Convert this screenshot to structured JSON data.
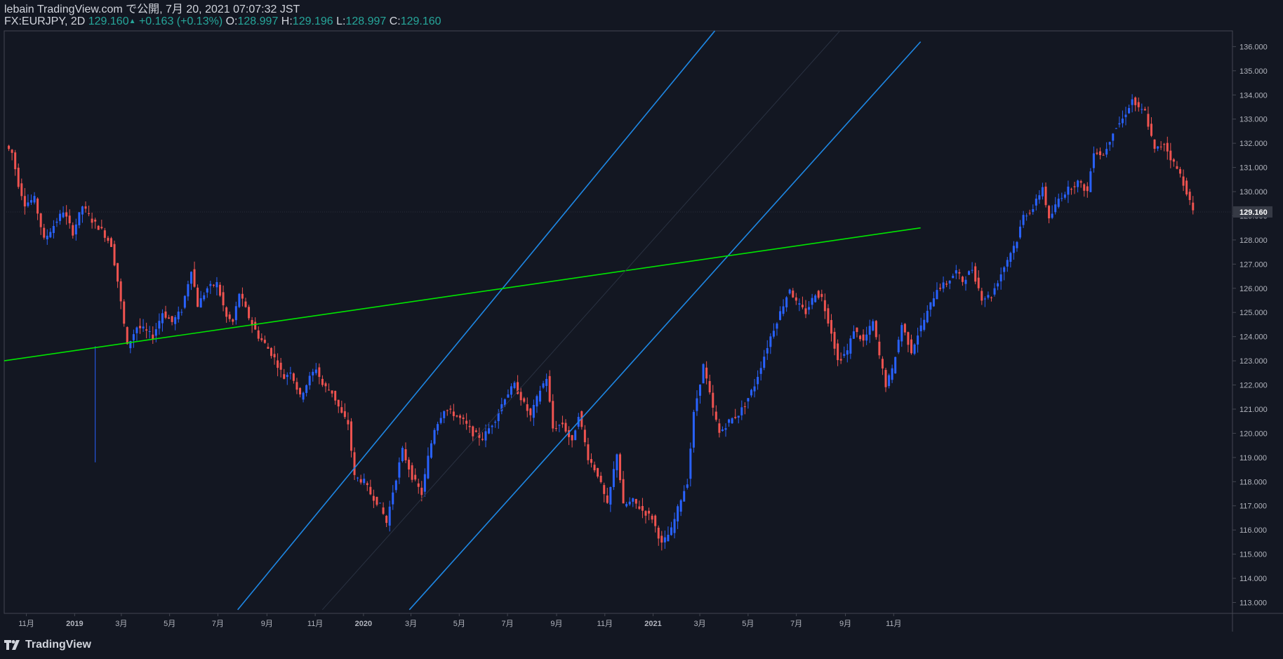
{
  "header": {
    "publisher": "lebain TradingView.com で公開, 7月 20, 2021 07:07:32 JST",
    "symbol": "FX:EURJPY, 2D",
    "last": "129.160",
    "change": "+0.163 (+0.13%)",
    "o_label": "O:",
    "o_value": "128.997",
    "h_label": "H:",
    "h_value": "129.196",
    "l_label": "L:",
    "l_value": "128.997",
    "c_label": "C:",
    "c_value": "129.160"
  },
  "footer": {
    "brand": "TradingView",
    "logo_icon": "tradingview-logo-icon"
  },
  "colors": {
    "background": "#131722",
    "up": "#2962ff",
    "down": "#ef5350",
    "channel": "#1e88e5",
    "support": "#00e600",
    "axis": "#787b86",
    "price_tag_bg": "#363a45"
  },
  "chart_data": {
    "type": "candlestick",
    "symbol": "EURJPY",
    "interval": "2D",
    "xlabels": [
      "11月",
      "2019",
      "3月",
      "5月",
      "7月",
      "9月",
      "11月",
      "2020",
      "3月",
      "5月",
      "7月",
      "9月",
      "11月",
      "2021",
      "3月",
      "5月",
      "7月",
      "9月",
      "11月"
    ],
    "yticks": [
      "113.000",
      "114.000",
      "115.000",
      "116.000",
      "117.000",
      "118.000",
      "119.000",
      "120.000",
      "121.000",
      "122.000",
      "123.000",
      "124.000",
      "125.000",
      "126.000",
      "127.000",
      "128.000",
      "129.000",
      "130.000",
      "131.000",
      "132.000",
      "133.000",
      "134.000",
      "135.000",
      "136.000"
    ],
    "ylim": [
      112.55,
      136.65
    ],
    "current_price": "129.160",
    "path_points": [
      [
        0,
        131.9
      ],
      [
        2,
        131.6
      ],
      [
        4,
        130.3
      ],
      [
        6,
        129.5
      ],
      [
        9,
        129.7
      ],
      [
        12,
        128.0
      ],
      [
        15,
        128.6
      ],
      [
        18,
        129.2
      ],
      [
        21,
        128.3
      ],
      [
        24,
        129.4
      ],
      [
        27,
        128.8
      ],
      [
        30,
        128.4
      ],
      [
        33,
        127.8
      ],
      [
        35,
        126.3
      ],
      [
        38,
        123.6
      ],
      [
        41,
        124.4
      ],
      [
        43,
        124.3
      ],
      [
        46,
        124.0
      ],
      [
        49,
        125.0
      ],
      [
        52,
        124.6
      ],
      [
        55,
        125.1
      ],
      [
        58,
        126.8
      ],
      [
        60,
        125.3
      ],
      [
        63,
        126.0
      ],
      [
        66,
        126.2
      ],
      [
        69,
        124.8
      ],
      [
        71,
        124.6
      ],
      [
        73,
        125.8
      ],
      [
        76,
        124.8
      ],
      [
        79,
        124.0
      ],
      [
        81,
        123.7
      ],
      [
        84,
        123.1
      ],
      [
        87,
        122.3
      ],
      [
        89,
        122.6
      ],
      [
        92,
        121.5
      ],
      [
        95,
        122.3
      ],
      [
        97,
        122.7
      ],
      [
        99,
        122.0
      ],
      [
        102,
        121.7
      ],
      [
        105,
        120.8
      ],
      [
        107,
        120.4
      ],
      [
        109,
        118.2
      ],
      [
        112,
        118.0
      ],
      [
        114,
        117.5
      ],
      [
        117,
        117.0
      ],
      [
        119,
        116.3
      ],
      [
        121,
        117.6
      ],
      [
        124,
        119.3
      ],
      [
        127,
        118.2
      ],
      [
        130,
        117.5
      ],
      [
        132,
        119.0
      ],
      [
        134,
        120.2
      ],
      [
        137,
        121.0
      ],
      [
        140,
        120.8
      ],
      [
        143,
        120.5
      ],
      [
        146,
        120.0
      ],
      [
        149,
        119.8
      ],
      [
        151,
        120.2
      ],
      [
        153,
        120.6
      ],
      [
        156,
        121.5
      ],
      [
        159,
        122.0
      ],
      [
        162,
        121.2
      ],
      [
        164,
        120.7
      ],
      [
        167,
        121.8
      ],
      [
        169,
        122.3
      ],
      [
        171,
        120.2
      ],
      [
        174,
        120.4
      ],
      [
        177,
        119.6
      ],
      [
        179,
        120.8
      ],
      [
        182,
        119.0
      ],
      [
        185,
        118.3
      ],
      [
        188,
        117.0
      ],
      [
        191,
        119.2
      ],
      [
        193,
        117.0
      ],
      [
        196,
        117.2
      ],
      [
        199,
        116.8
      ],
      [
        202,
        116.5
      ],
      [
        205,
        115.4
      ],
      [
        208,
        116.0
      ],
      [
        211,
        117.3
      ],
      [
        213,
        118.0
      ],
      [
        215,
        120.8
      ],
      [
        218,
        122.8
      ],
      [
        221,
        121.0
      ],
      [
        223,
        120.0
      ],
      [
        226,
        120.5
      ],
      [
        229,
        120.8
      ],
      [
        231,
        121.2
      ],
      [
        234,
        122.0
      ],
      [
        237,
        123.2
      ],
      [
        239,
        124.0
      ],
      [
        242,
        125.0
      ],
      [
        245,
        126.0
      ],
      [
        247,
        125.4
      ],
      [
        250,
        125.0
      ],
      [
        253,
        125.8
      ],
      [
        255,
        125.6
      ],
      [
        258,
        124.2
      ],
      [
        260,
        123.0
      ],
      [
        263,
        123.4
      ],
      [
        265,
        124.3
      ],
      [
        268,
        123.8
      ],
      [
        271,
        124.6
      ],
      [
        273,
        123.2
      ],
      [
        275,
        122.0
      ],
      [
        277,
        122.6
      ],
      [
        280,
        124.5
      ],
      [
        283,
        123.4
      ],
      [
        285,
        124.1
      ],
      [
        288,
        125.0
      ],
      [
        291,
        126.0
      ],
      [
        294,
        126.2
      ],
      [
        297,
        126.7
      ],
      [
        299,
        126.3
      ],
      [
        302,
        126.8
      ],
      [
        305,
        125.6
      ],
      [
        308,
        125.7
      ],
      [
        311,
        126.6
      ],
      [
        314,
        127.5
      ],
      [
        316,
        128.0
      ],
      [
        318,
        129.0
      ],
      [
        321,
        129.3
      ],
      [
        324,
        130.2
      ],
      [
        326,
        128.8
      ],
      [
        329,
        129.7
      ],
      [
        332,
        130.1
      ],
      [
        335,
        130.4
      ],
      [
        338,
        130.0
      ],
      [
        340,
        131.7
      ],
      [
        343,
        131.5
      ],
      [
        346,
        132.5
      ],
      [
        349,
        133.0
      ],
      [
        352,
        133.8
      ],
      [
        354,
        133.4
      ],
      [
        356,
        133.3
      ],
      [
        359,
        131.7
      ],
      [
        362,
        132.0
      ],
      [
        364,
        131.4
      ],
      [
        367,
        130.7
      ],
      [
        369,
        130.0
      ],
      [
        371,
        129.16
      ]
    ],
    "lines": [
      {
        "name": "channel-upper",
        "color": "#1e88e5",
        "from": [
          "2019-07-26",
          112.7
        ],
        "to": [
          "2021-03-20",
          136.65
        ]
      },
      {
        "name": "channel-lower",
        "color": "#1e88e5",
        "from": [
          "2020-02-28",
          112.7
        ],
        "to": [
          "2021-12-05",
          136.2
        ]
      },
      {
        "name": "support",
        "color": "#00e600",
        "from": [
          "2018-10-04",
          123.0
        ],
        "to": [
          "2021-12-05",
          128.5
        ]
      }
    ]
  }
}
